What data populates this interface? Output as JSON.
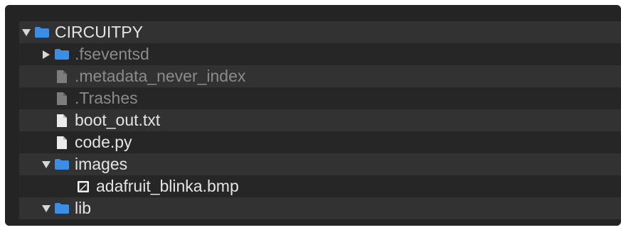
{
  "colors": {
    "folder": "#3b8ee8",
    "file": "#ececec",
    "file_dim": "#7d7d7d",
    "text": "#e4e4e4",
    "text_dim": "#8b8b8b",
    "row_even": "#323232",
    "row_odd": "#262626",
    "background": "#242424"
  },
  "tree": {
    "items": [
      {
        "label": "CIRCUITPY",
        "type": "folder",
        "expanded": true,
        "icon": "folder-icon"
      },
      {
        "label": ".fseventsd",
        "type": "folder",
        "expanded": false,
        "icon": "folder-icon"
      },
      {
        "label": ".metadata_never_index",
        "type": "file",
        "icon": "file-icon"
      },
      {
        "label": ".Trashes",
        "type": "file",
        "icon": "file-icon"
      },
      {
        "label": "boot_out.txt",
        "type": "file",
        "icon": "file-icon"
      },
      {
        "label": "code.py",
        "type": "file",
        "icon": "file-icon"
      },
      {
        "label": "images",
        "type": "folder",
        "expanded": true,
        "icon": "folder-icon"
      },
      {
        "label": "adafruit_blinka.bmp",
        "type": "image",
        "icon": "image-file-icon"
      },
      {
        "label": "lib",
        "type": "folder",
        "expanded": true,
        "icon": "folder-icon"
      }
    ]
  }
}
